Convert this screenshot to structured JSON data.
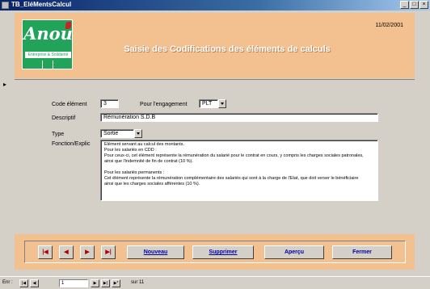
{
  "window": {
    "title": "TB_EléMentsCalcul",
    "buttons": [
      "_",
      "□",
      "×"
    ]
  },
  "header": {
    "logo_text": "Anou",
    "logo_sub": "Entreprise & Solidarité",
    "logo_mark": "D",
    "title": "Saisie des Codifications des éléments de calculs",
    "date": "11/02/2001",
    "colors": {
      "background": "#f3c090",
      "logo": "#21a35a"
    }
  },
  "record_pointer": "▸",
  "form": {
    "code_label": "Code élément",
    "code_value": "3",
    "rattachement_label": "Pour l'engagement",
    "rattachement_value": "PLT",
    "descriptif_label": "Descriptif",
    "descriptif_value": "Rémunération S.D.B",
    "type_label": "Type",
    "type_value": "Sortie",
    "fonction_label": "Fonction/Explic",
    "fonction_lines": [
      "Elément servant au calcul des montants.",
      "Pour les salariés en CDD :",
      "Pour ceux-ci, cet élément représente la rémunération du salarié pour le contrat en cours, y compris les charges sociales patronales,",
      "ainsi que l'indemnité de fin de contrat (10 %).",
      "",
      "Pour les salariés permanents :",
      "Cet élément représente la rémunération complémentaire des salariés qui sont à la charge de l'Etat, que doit verser le bénéficiaire",
      "ainsi que les charges sociales afférentes (10 %)."
    ]
  },
  "footer": {
    "nav": [
      "|◀",
      "◀",
      "▶",
      "▶|"
    ],
    "nouveau": "Nouveau",
    "supprimer": "Supprimer",
    "apercu": "Aperçu",
    "fermer": "Fermer"
  },
  "statusbar": {
    "label": "Enr :",
    "current": "1",
    "total": "sur 11",
    "nav": [
      "|◀",
      "◀",
      "▶",
      "▶|",
      "▶*"
    ]
  }
}
